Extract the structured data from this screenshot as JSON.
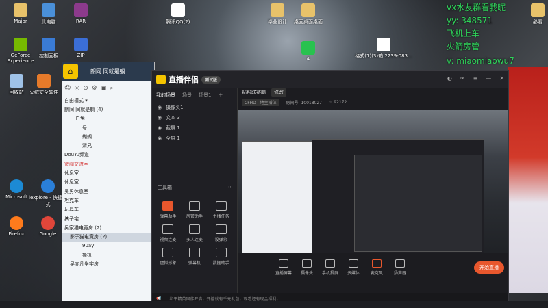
{
  "desktop_icons": [
    {
      "label": "Major",
      "icon": "folder-icon"
    },
    {
      "label": "此电脑",
      "icon": "computer-icon"
    },
    {
      "label": "RAR",
      "icon": "rar-icon"
    },
    {
      "label": "GeForce Experience",
      "icon": "geforce-icon"
    },
    {
      "label": "控制面板",
      "icon": "control-panel-icon"
    },
    {
      "label": "ZIP",
      "icon": "zip-icon"
    },
    {
      "label": "回收站",
      "icon": "recycle-bin-icon"
    },
    {
      "label": "火绒安全软件",
      "icon": "huorong-icon"
    },
    {
      "label": "Microsoft",
      "icon": "edge-icon"
    },
    {
      "label": "iexplore - 快捷方式",
      "icon": "ie-icon"
    },
    {
      "label": "Firefox",
      "icon": "firefox-icon"
    },
    {
      "label": "Google",
      "icon": "chrome-icon"
    },
    {
      "label": "腾讯QQ(2)",
      "icon": "doc-icon"
    },
    {
      "label": "毕业设计",
      "icon": "folder-icon"
    },
    {
      "label": "桌面桌面桌面",
      "icon": "folder-icon"
    },
    {
      "label": "4",
      "icon": "green-app-icon"
    },
    {
      "label": "格式(1)(3)箱 2239-083...",
      "icon": "doc-icon"
    },
    {
      "label": "必看",
      "icon": "folder-icon"
    }
  ],
  "overlay_lines": [
    "vx水友群看我昵",
    "yy: 348571",
    "飞机上车",
    "火箭房管",
    "v: miaomiaowu7"
  ],
  "chat_window": {
    "title": "朗同 同就是躺",
    "mode_label": "自由模式",
    "members": [
      {
        "text": "朗同 同就是躺 (4)",
        "selected": false
      },
      {
        "text": "白兔",
        "selected": false
      },
      {
        "text": "号",
        "selected": false
      },
      {
        "text": "蝴蝴",
        "selected": false
      },
      {
        "text": "渭兄",
        "selected": false
      },
      {
        "text": "DouYu频道",
        "selected": false
      },
      {
        "text": "微阁交流室",
        "selected": false
      },
      {
        "text": "休息室",
        "selected": false
      },
      {
        "text": "休息室",
        "selected": false
      },
      {
        "text": "吴男休息室",
        "selected": false
      },
      {
        "text": "坦克车",
        "selected": false
      },
      {
        "text": "玩具车",
        "selected": false
      },
      {
        "text": "搞子宅",
        "selected": false
      },
      {
        "text": "吴家猫电竞房 (2)",
        "selected": false
      },
      {
        "text": "影子猫电竞房 (2)",
        "selected": true
      },
      {
        "text": "90ay",
        "selected": false
      },
      {
        "text": "撕扒",
        "selected": false
      },
      {
        "text": "吴亦凡坐牢房",
        "selected": false
      }
    ]
  },
  "app": {
    "brand": "直播伴侣",
    "badge": "测试版",
    "scene_tabs": [
      "我的场景",
      "场景",
      "场景1"
    ],
    "sources": [
      "摄像头1",
      "文本 3",
      "截屏 1",
      "全屏 1"
    ],
    "tools_header": "工具箱",
    "tools": [
      {
        "label": "弹幕助手",
        "icon": "danmaku-icon"
      },
      {
        "label": "房管助手",
        "icon": "admin-icon"
      },
      {
        "label": "主播任务",
        "icon": "task-icon"
      },
      {
        "label": "视频连麦",
        "icon": "video-link-icon"
      },
      {
        "label": "多人连麦",
        "icon": "multi-link-icon"
      },
      {
        "label": "设弹幕",
        "icon": "set-danmaku-icon"
      },
      {
        "label": "虚拟形象",
        "icon": "avatar-icon"
      },
      {
        "label": "弹幕机",
        "icon": "danmaku-machine-icon"
      },
      {
        "label": "数据助手",
        "icon": "data-icon"
      }
    ],
    "room_title": "钻粉联赛脑",
    "edit_label": "修改",
    "quality": "CFHD · 地主插位",
    "room_id_label": "房间号: 10018027",
    "viewers": "92172",
    "bottom_buttons": [
      "直播屏幕",
      "摄像头",
      "手机投屏",
      "多媒体",
      "麦克风",
      "扬声器"
    ],
    "start_label": "开始直播",
    "status_text": "和平精英国佛开启，开播就有千元礼包，观看还有现金福利。"
  }
}
